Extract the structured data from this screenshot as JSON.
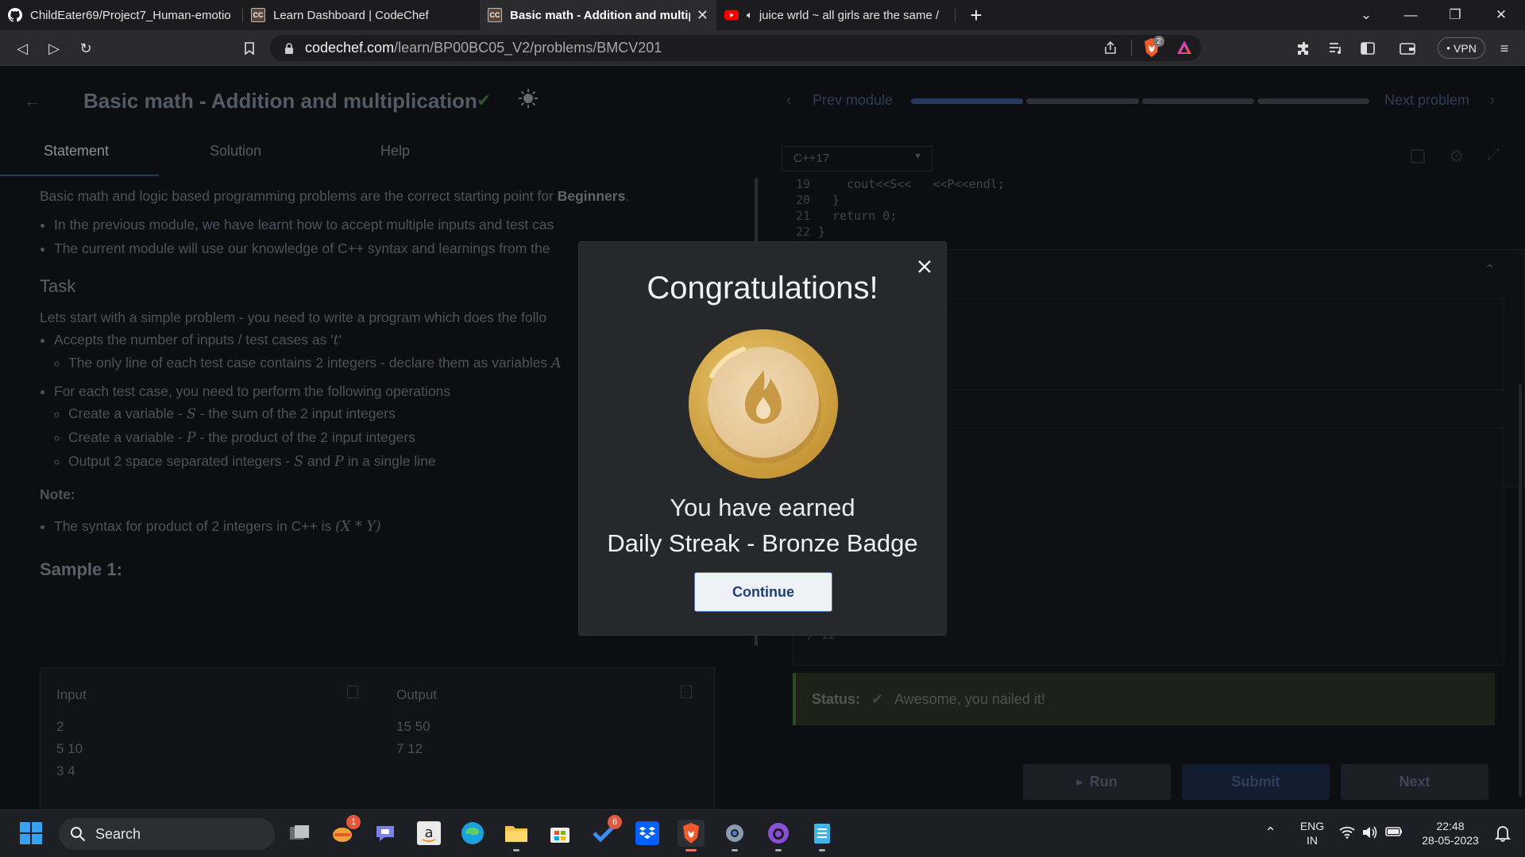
{
  "browser": {
    "tabs": [
      {
        "title": "ChildEater69/Project7_Human-emotio",
        "icon": "github-icon"
      },
      {
        "title": "Learn Dashboard | CodeChef",
        "icon": "codechef-icon"
      },
      {
        "title": "Basic math - Addition and multipl",
        "icon": "codechef-icon",
        "active": true
      },
      {
        "title": "juice wrld ~ all girls are the same /",
        "icon": "youtube-icon"
      }
    ],
    "favicon_text": "CC",
    "url_host": "codechef.com",
    "url_path": "/learn/BP00BC05_V2/problems/BMCV201",
    "shield_count": "2",
    "vpn_label": "VPN"
  },
  "page": {
    "title": "Basic math - Addition and multiplication",
    "prev_module": "Prev module",
    "next_problem": "Next problem",
    "progress_segments": 4,
    "progress_filled": 1,
    "tabs": [
      "Statement",
      "Solution",
      "Help"
    ],
    "statement": {
      "intro": "Basic math and logic based programming problems are the correct starting point for",
      "intro_bold": "Beginners",
      "bullets": [
        "In the previous module, we have learnt how to accept multiple inputs and test cas",
        "The current module will use our knowledge of C++ syntax and learnings from the"
      ],
      "task_heading": "Task",
      "task_intro": "Lets start with a simple problem - you need to write a program which does the follo",
      "task_b1": "Accepts the number of inputs / test cases as '",
      "task_b1_var": "t",
      "task_b1_sub": "The only line of each test case contains 2 integers - declare them as variables",
      "task_b1_sub_var": "A",
      "task_b2": "For each test case, you need to perform the following operations",
      "task_b2_sub1_pre": "Create a variable -",
      "task_b2_sub1_var": "S",
      "task_b2_sub1_post": "- the sum of the 2 input integers",
      "task_b2_sub2_pre": "Create a variable -",
      "task_b2_sub2_var": "P",
      "task_b2_sub2_post": "- the product of the 2 input integers",
      "task_b2_sub3_pre": "Output 2 space separated integers -",
      "task_b2_sub3_var1": "S",
      "task_b2_sub3_mid": "and",
      "task_b2_sub3_var2": "P",
      "task_b2_sub3_post": "in a single line",
      "note_heading": "Note:",
      "note_text": "The syntax for product of 2 integers in C++ is",
      "note_formula": "(X * Y)",
      "sample_heading": "Sample 1:",
      "sample_input_label": "Input",
      "sample_output_label": "Output",
      "sample_input": [
        "2",
        "5 10",
        "3 4"
      ],
      "sample_output": [
        "15 50",
        "7 12"
      ]
    },
    "editor": {
      "language": "C++17",
      "code_lines": [
        {
          "num": "19",
          "code": "    cout<<S<<   <<P<<endl;"
        },
        {
          "num": "20",
          "code": "  }"
        },
        {
          "num": "21",
          "code": "  return 0;"
        },
        {
          "num": "22",
          "code": "}"
        }
      ],
      "output_fragment": "/ 12"
    },
    "status_label": "Status:",
    "status_text": "Awesome, you nailed it!",
    "run_label": "Run",
    "submit_label": "Submit",
    "next_label": "Next"
  },
  "modal": {
    "title": "Congratulations!",
    "earned_text": "You have earned",
    "badge_name": "Daily Streak - Bronze Badge",
    "continue_label": "Continue"
  },
  "taskbar": {
    "search_label": "Search",
    "notif_badge_1": "1",
    "notif_badge_2": "6",
    "lang_line1": "ENG",
    "lang_line2": "IN",
    "time": "22:48",
    "date": "28-05-2023"
  },
  "colors": {
    "modal_bg": "#26282c",
    "badge_gold": "#d4a84e",
    "continue_border": "#5a7fc0",
    "status_green": "#2b4a25"
  }
}
